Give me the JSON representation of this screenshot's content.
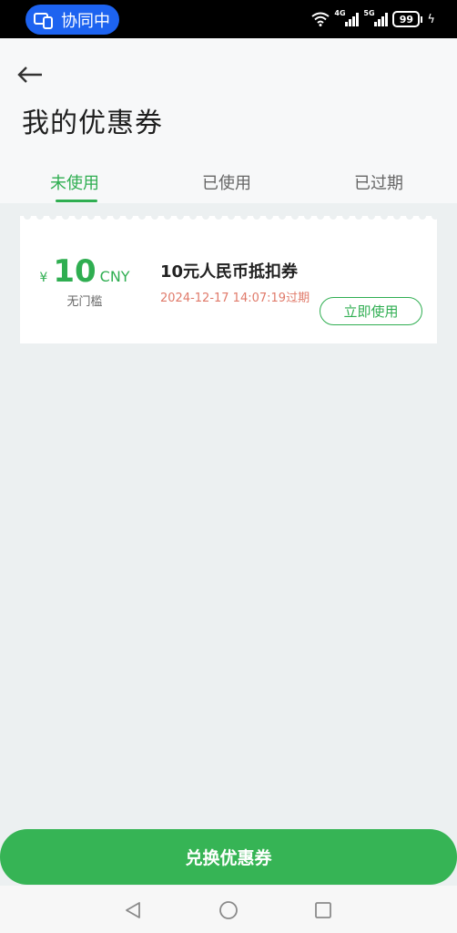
{
  "status_bar": {
    "collab_label": "协同中",
    "network_1": "4G",
    "network_2": "5G",
    "battery_level": "99"
  },
  "header": {
    "title": "我的优惠券"
  },
  "tabs": [
    {
      "label": "未使用",
      "active": true
    },
    {
      "label": "已使用",
      "active": false
    },
    {
      "label": "已过期",
      "active": false
    }
  ],
  "coupons": [
    {
      "currency_symbol": "¥",
      "amount": "10",
      "unit": "CNY",
      "threshold": "无门槛",
      "name": "10元人民币抵扣券",
      "expiry": "2024-12-17 14:07:19过期",
      "action_label": "立即使用"
    }
  ],
  "footer": {
    "redeem_label": "兑换优惠券"
  },
  "colors": {
    "accent": "#2fae51",
    "expiry": "#e07a6a",
    "collab_pill": "#1d63f0"
  }
}
